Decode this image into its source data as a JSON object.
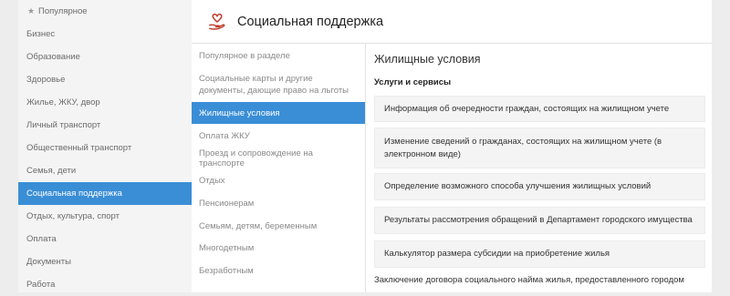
{
  "sidebar": {
    "items": [
      {
        "label": "Популярное",
        "icon": "star-icon"
      },
      {
        "label": "Бизнес"
      },
      {
        "label": "Образование"
      },
      {
        "label": "Здоровье"
      },
      {
        "label": "Жилье, ЖКУ, двор"
      },
      {
        "label": "Личный транспорт"
      },
      {
        "label": "Общественный транспорт"
      },
      {
        "label": "Семья, дети"
      },
      {
        "label": "Социальная поддержка",
        "active": true
      },
      {
        "label": "Отдых, культура, спорт"
      },
      {
        "label": "Оплата"
      },
      {
        "label": "Документы"
      },
      {
        "label": "Работа"
      }
    ]
  },
  "header": {
    "title": "Социальная поддержка",
    "icon": "hand-heart-icon"
  },
  "submenu": {
    "items": [
      {
        "label": "Популярное в разделе"
      },
      {
        "label": "Социальные карты и другие документы, дающие право на льготы"
      },
      {
        "label": "Жилищные условия",
        "active": true
      },
      {
        "label": "Оплата ЖКУ"
      },
      {
        "label": "Проезд и сопровождение на транспорте"
      },
      {
        "label": "Отдых"
      },
      {
        "label": "Пенсионерам"
      },
      {
        "label": "Семьям, детям, беременным"
      },
      {
        "label": "Многодетным"
      },
      {
        "label": "Безработным"
      }
    ]
  },
  "content": {
    "title": "Жилищные условия",
    "subtitle": "Услуги и сервисы",
    "services": [
      {
        "label": "Информация об очередности граждан, состоящих на жилищном учете"
      },
      {
        "label": "Изменение сведений о гражданах, состоящих на жилищном учете (в электронном виде)"
      },
      {
        "label": "Определение возможного способа улучшения жилищных условий"
      },
      {
        "label": "Результаты рассмотрения обращений в Департамент городского имущества"
      },
      {
        "label": "Калькулятор размера субсидии на приобретение жилья"
      }
    ],
    "extra_link": "Заключение договора социального найма жилья, предоставленного городом"
  },
  "colors": {
    "accent": "#3a8ed6",
    "heart": "#c0392b"
  }
}
